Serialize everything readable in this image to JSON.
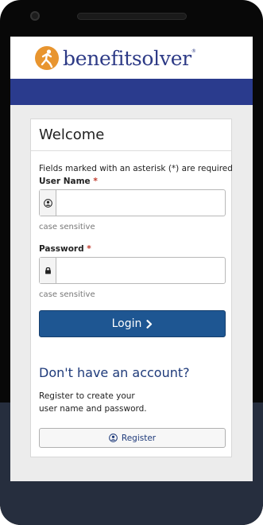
{
  "brand": {
    "name": "benefitsolver",
    "trademark": "®",
    "primary_color": "#2a3b8d",
    "accent_color": "#e8952f",
    "logo_icon": "running-figure-logo-icon"
  },
  "login_card": {
    "title": "Welcome",
    "required_note": "Fields marked with an asterisk (*) are required",
    "username": {
      "label": "User Name",
      "required_mark": "*",
      "icon": "user-icon",
      "value": "",
      "hint": "case sensitive"
    },
    "password": {
      "label": "Password",
      "required_mark": "*",
      "icon": "lock-icon",
      "value": "",
      "hint": "case sensitive"
    },
    "login_button": {
      "label": "Login",
      "icon": "chevron-right-icon",
      "color": "#1e5692"
    }
  },
  "register": {
    "heading": "Don't have an account?",
    "text_line1": "Register to create your",
    "text_line2": "user name and password.",
    "button_label": "Register",
    "button_icon": "user-icon"
  }
}
